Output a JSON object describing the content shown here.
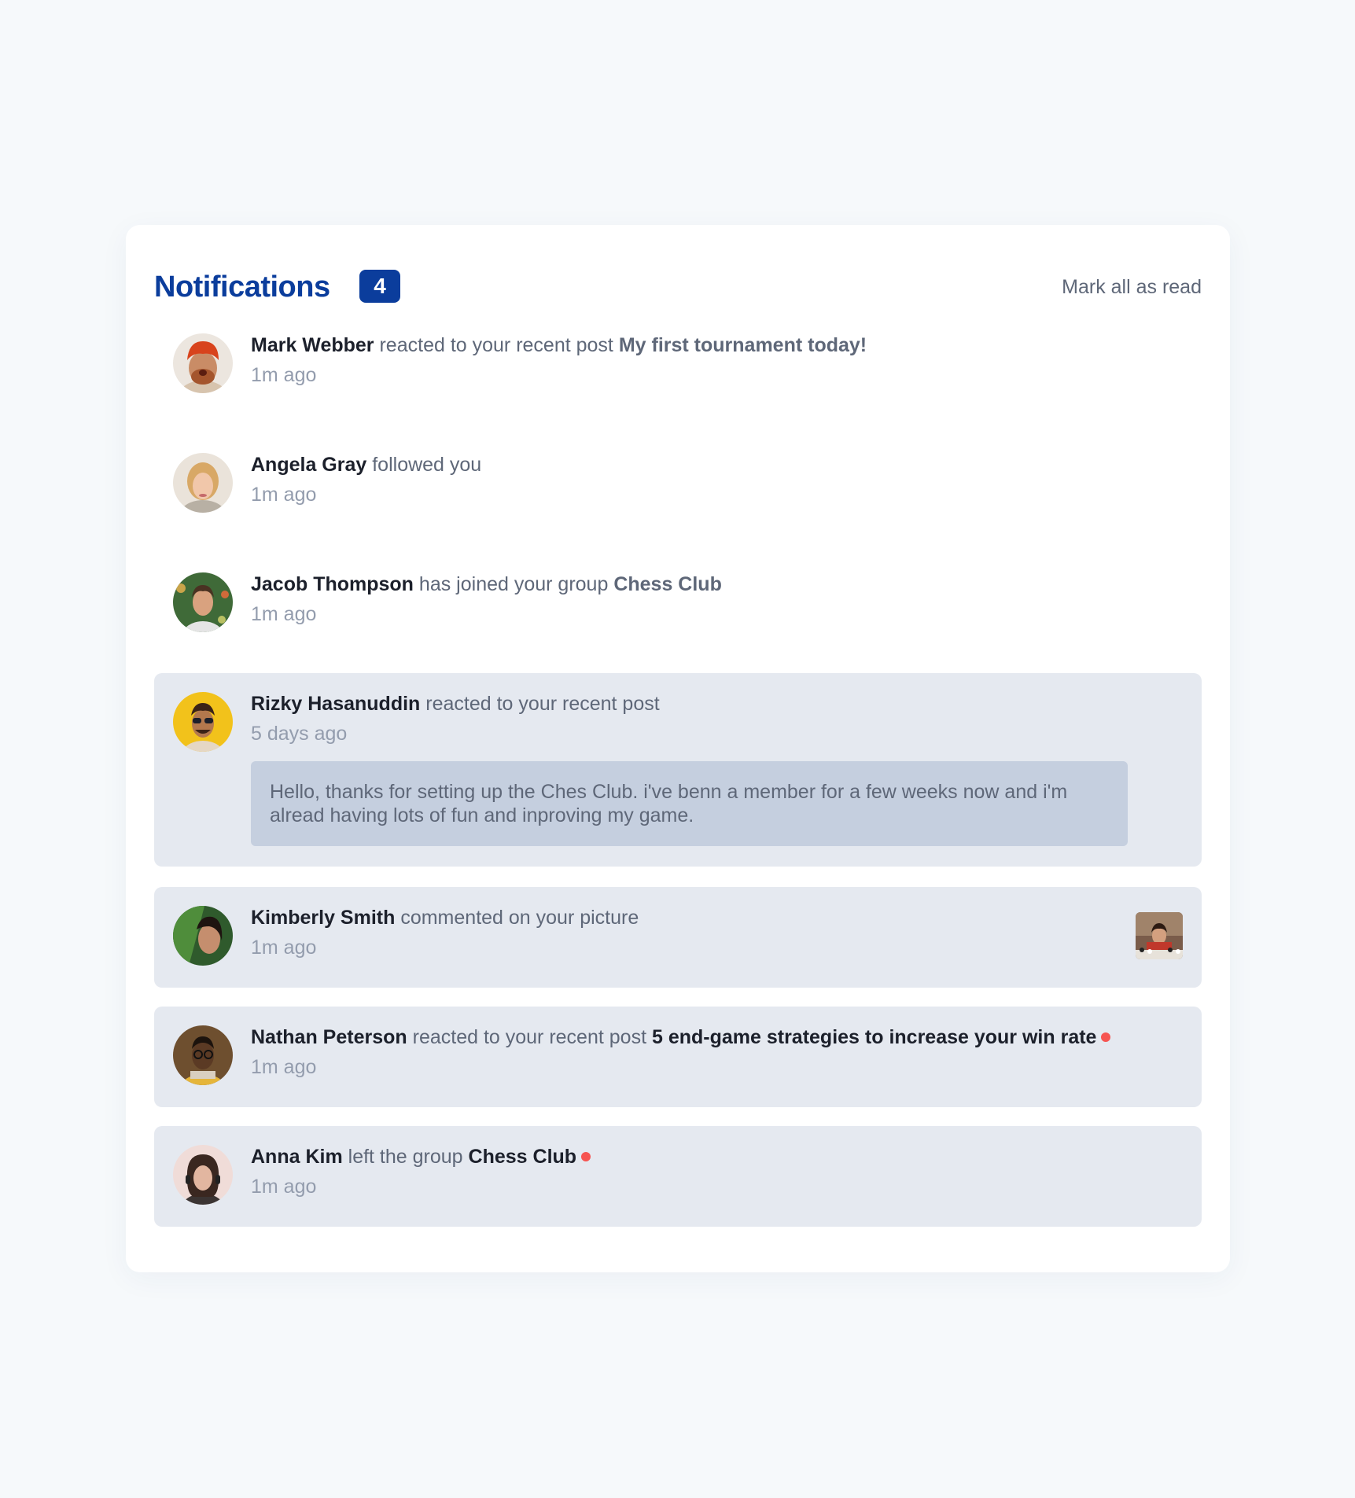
{
  "header": {
    "title": "Notifications",
    "unread_count": "4",
    "mark_all_label": "Mark all as read"
  },
  "colors": {
    "brand_blue": "#0b3d9c",
    "unread_background": "#e5e9f0",
    "message_background": "#c5cfdf",
    "unread_dot": "#f65552",
    "page_background": "#f6f9fb"
  },
  "notifications": [
    {
      "user": "Mark Webber",
      "action": "reacted to your recent post",
      "target": "My first tournament today!",
      "time": "1m ago",
      "avatar_icon": "avatar-mark-webber"
    },
    {
      "user": "Angela Gray",
      "action": "followed you",
      "time": "1m ago",
      "avatar_icon": "avatar-angela-gray"
    },
    {
      "user": "Jacob Thompson",
      "action": "has joined your group",
      "target": "Chess Club",
      "time": "1m ago",
      "avatar_icon": "avatar-jacob-thompson"
    },
    {
      "user": "Rizky Hasanuddin",
      "action": "reacted to your recent post",
      "time": "5 days ago",
      "message": "Hello, thanks for setting up the Ches Club. i've benn a member for a few weeks now and i'm alread having lots of fun and inproving my game.",
      "avatar_icon": "avatar-rizky-hasanuddin"
    },
    {
      "user": "Kimberly Smith",
      "action": "commented on your picture",
      "time": "1m ago",
      "avatar_icon": "avatar-kimberly-smith",
      "picture_icon": "chess-picture-thumbnail"
    },
    {
      "user": "Nathan Peterson",
      "action": "reacted to your recent post",
      "target": "5 end-game strategies to increase your win rate",
      "time": "1m ago",
      "avatar_icon": "avatar-nathan-peterson"
    },
    {
      "user": "Anna Kim",
      "action": "left the group",
      "target": "Chess Club",
      "time": "1m ago",
      "avatar_icon": "avatar-anna-kim"
    }
  ]
}
